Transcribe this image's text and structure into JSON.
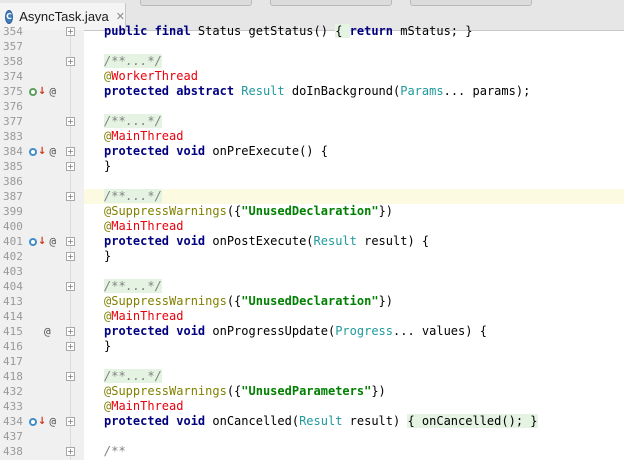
{
  "tab": {
    "title": "AsyncTask.java",
    "icon": "java-class-icon",
    "icon_letter": "C",
    "close": "✕"
  },
  "colors": {
    "keyword": "#000080",
    "annotation_name": "#ea000c",
    "type": "#20999d",
    "string": "#008000",
    "comment": "#808080",
    "gutter": "#f0f0f0",
    "current_line": "#fcfae1"
  },
  "lines": [
    {
      "n": "354",
      "parts": [
        {
          "c": "kw",
          "t": "public final "
        },
        {
          "c": "plain",
          "t": "Status getStatus() "
        },
        {
          "c": "fold-box",
          "t": "{ "
        },
        {
          "c": "kw",
          "t": "return "
        },
        {
          "c": "plain",
          "t": "mStatus; }"
        }
      ],
      "fold": true
    },
    {
      "n": "357",
      "parts": []
    },
    {
      "n": "358",
      "parts": [
        {
          "c": "fold-box comment",
          "t": "/**...*/"
        }
      ],
      "fold": true
    },
    {
      "n": "374",
      "parts": [
        {
          "c": "ann-at",
          "t": "@"
        },
        {
          "c": "ann-red",
          "t": "WorkerThread"
        }
      ]
    },
    {
      "n": "375",
      "marker": "abstract",
      "parts": [
        {
          "c": "kw",
          "t": "protected abstract "
        },
        {
          "c": "type",
          "t": "Result "
        },
        {
          "c": "plain",
          "t": "doInBackground("
        },
        {
          "c": "type",
          "t": "Params"
        },
        {
          "c": "plain",
          "t": "... params);"
        }
      ]
    },
    {
      "n": "376",
      "parts": []
    },
    {
      "n": "377",
      "parts": [
        {
          "c": "fold-box comment",
          "t": "/**...*/"
        }
      ],
      "fold": true
    },
    {
      "n": "383",
      "parts": [
        {
          "c": "ann-at",
          "t": "@"
        },
        {
          "c": "ann-red",
          "t": "MainThread"
        }
      ]
    },
    {
      "n": "384",
      "marker": "overridden",
      "parts": [
        {
          "c": "kw",
          "t": "protected void "
        },
        {
          "c": "plain",
          "t": "onPreExecute() {"
        }
      ],
      "fold": true
    },
    {
      "n": "385",
      "parts": [
        {
          "c": "plain",
          "t": "}"
        }
      ],
      "fold": true
    },
    {
      "n": "386",
      "parts": []
    },
    {
      "n": "387",
      "highlight": true,
      "parts": [
        {
          "c": "fold-box comment",
          "t": "/**...*/"
        }
      ],
      "fold": true
    },
    {
      "n": "399",
      "parts": [
        {
          "c": "ann-olive",
          "t": "@SuppressWarnings"
        },
        {
          "c": "plain",
          "t": "({"
        },
        {
          "c": "str",
          "t": "\"UnusedDeclaration\""
        },
        {
          "c": "plain",
          "t": "})"
        }
      ]
    },
    {
      "n": "400",
      "parts": [
        {
          "c": "ann-at",
          "t": "@"
        },
        {
          "c": "ann-red",
          "t": "MainThread"
        }
      ]
    },
    {
      "n": "401",
      "marker": "overridden",
      "parts": [
        {
          "c": "kw",
          "t": "protected void "
        },
        {
          "c": "plain",
          "t": "onPostExecute("
        },
        {
          "c": "type",
          "t": "Result "
        },
        {
          "c": "plain",
          "t": "result) {"
        }
      ],
      "fold": true
    },
    {
      "n": "402",
      "parts": [
        {
          "c": "plain",
          "t": "}"
        }
      ],
      "fold": true
    },
    {
      "n": "403",
      "parts": []
    },
    {
      "n": "404",
      "parts": [
        {
          "c": "fold-box comment",
          "t": "/**...*/"
        }
      ],
      "fold": true
    },
    {
      "n": "413",
      "parts": [
        {
          "c": "ann-olive",
          "t": "@SuppressWarnings"
        },
        {
          "c": "plain",
          "t": "({"
        },
        {
          "c": "str",
          "t": "\"UnusedDeclaration\""
        },
        {
          "c": "plain",
          "t": "})"
        }
      ]
    },
    {
      "n": "414",
      "parts": [
        {
          "c": "ann-at",
          "t": "@"
        },
        {
          "c": "ann-red",
          "t": "MainThread"
        }
      ]
    },
    {
      "n": "415",
      "marker": "at-only",
      "parts": [
        {
          "c": "kw",
          "t": "protected void "
        },
        {
          "c": "plain",
          "t": "onProgressUpdate("
        },
        {
          "c": "type",
          "t": "Progress"
        },
        {
          "c": "plain",
          "t": "... values) {"
        }
      ],
      "fold": true
    },
    {
      "n": "416",
      "parts": [
        {
          "c": "plain",
          "t": "}"
        }
      ],
      "fold": true
    },
    {
      "n": "417",
      "parts": []
    },
    {
      "n": "418",
      "parts": [
        {
          "c": "fold-box comment",
          "t": "/**...*/"
        }
      ],
      "fold": true
    },
    {
      "n": "432",
      "parts": [
        {
          "c": "ann-olive",
          "t": "@SuppressWarnings"
        },
        {
          "c": "plain",
          "t": "({"
        },
        {
          "c": "str",
          "t": "\"UnusedParameters\""
        },
        {
          "c": "plain",
          "t": "})"
        }
      ]
    },
    {
      "n": "433",
      "parts": [
        {
          "c": "ann-at",
          "t": "@"
        },
        {
          "c": "ann-red",
          "t": "MainThread"
        }
      ]
    },
    {
      "n": "434",
      "marker": "overridden",
      "parts": [
        {
          "c": "kw",
          "t": "protected void "
        },
        {
          "c": "plain",
          "t": "onCancelled("
        },
        {
          "c": "type",
          "t": "Result "
        },
        {
          "c": "plain",
          "t": "result) "
        },
        {
          "c": "fold-box",
          "t": "{ onCancelled(); }"
        }
      ],
      "fold": true
    },
    {
      "n": "437",
      "parts": []
    },
    {
      "n": "438",
      "parts": [
        {
          "c": "comment",
          "t": "/**"
        }
      ],
      "fold": true
    }
  ]
}
